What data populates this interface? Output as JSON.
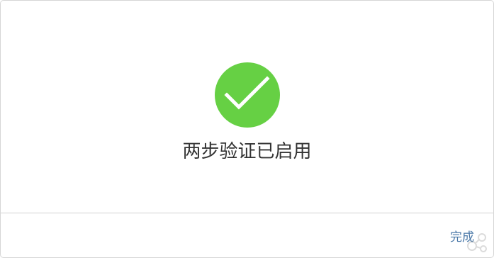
{
  "dialog": {
    "message": "两步验证已启用",
    "done_label": "完成"
  },
  "icons": {
    "status": "checkmark-circle-icon",
    "watermark": "watermark-logo-icon"
  },
  "colors": {
    "success": "#66d044",
    "link": "#4a78a8",
    "text": "#333333"
  }
}
